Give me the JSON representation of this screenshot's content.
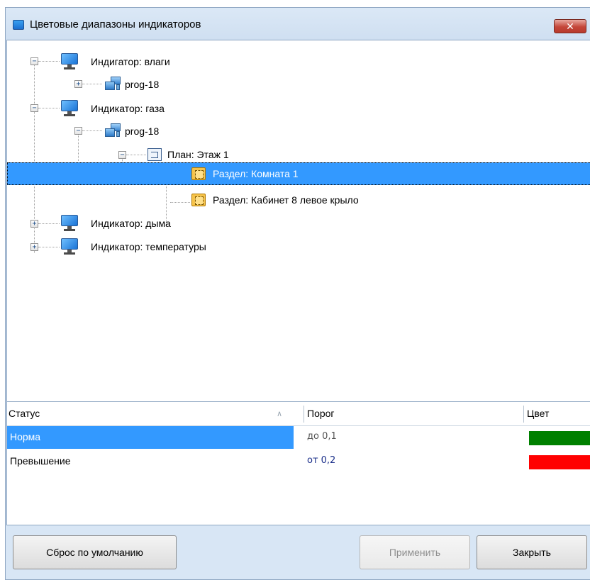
{
  "window": {
    "title": "Цветовые диапазоны индикаторов",
    "close_glyph": "✕"
  },
  "tree": {
    "nodes": [
      {
        "label": "Индигатор: влаги",
        "icon": "monitor-icon",
        "expander": "−"
      },
      {
        "label": "prog-18",
        "icon": "network-icon",
        "expander": "+"
      },
      {
        "label": "Индикатор: газа",
        "icon": "monitor-icon",
        "expander": "−"
      },
      {
        "label": "prog-18",
        "icon": "network-icon",
        "expander": "−"
      },
      {
        "label": "План: Этаж 1",
        "icon": "plan-icon",
        "expander": "−"
      },
      {
        "label": "Раздел: Комната 1",
        "icon": "room-icon",
        "selected": true
      },
      {
        "label": "Раздел: Кабинет 8 левое крыло",
        "icon": "room-icon"
      },
      {
        "label": "Индикатор: дыма",
        "icon": "monitor-icon",
        "expander": "+"
      },
      {
        "label": "Индикатор: температуры",
        "icon": "monitor-icon",
        "expander": "+"
      }
    ]
  },
  "grid": {
    "columns": [
      "Статус",
      "Порог",
      "Цвет"
    ],
    "sort_glyph": "∧",
    "rows": [
      {
        "status": "Норма",
        "threshold": "до 0,1",
        "color": "#008000",
        "selected": true
      },
      {
        "status": "Превышение",
        "threshold": "от 0,2",
        "color": "#ff0000"
      }
    ]
  },
  "buttons": {
    "reset": "Сброс по умолчанию",
    "apply": "Применить",
    "close": "Закрыть"
  }
}
